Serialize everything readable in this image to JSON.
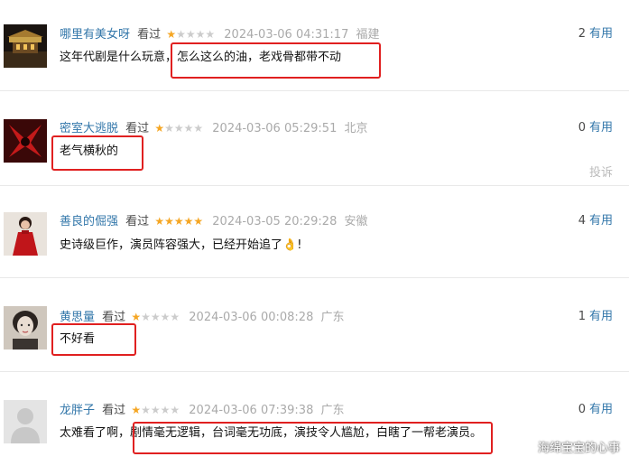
{
  "comments": [
    {
      "user": "哪里有美女呀",
      "watched": "看过",
      "rating": 1,
      "time": "2024-03-06 04:31:17",
      "location": "福建",
      "useful_count": "2",
      "useful_label": "有用",
      "text": "这年代剧是什么玩意，怎么这么的油，老戏骨都带不动",
      "avatar": "night-building-avatar"
    },
    {
      "user": "密室大逃脱",
      "watched": "看过",
      "rating": 1,
      "time": "2024-03-06 05:29:51",
      "location": "北京",
      "useful_count": "0",
      "useful_label": "有用",
      "text": "老气横秋的",
      "report": "投诉",
      "avatar": "red-claw-avatar"
    },
    {
      "user": "善良的倔强",
      "watched": "看过",
      "rating": 5,
      "time": "2024-03-05 20:29:28",
      "location": "安徽",
      "useful_count": "4",
      "useful_label": "有用",
      "text": "史诗级巨作，演员阵容强大，已经开始追了",
      "text_suffix": "👌!",
      "avatar": "red-dress-avatar"
    },
    {
      "user": "黄思量",
      "watched": "看过",
      "rating": 1,
      "time": "2024-03-06 00:08:28",
      "location": "广东",
      "useful_count": "1",
      "useful_label": "有用",
      "text": "不好看",
      "avatar": "vintage-portrait-avatar"
    },
    {
      "user": "龙胖子",
      "watched": "看过",
      "rating": 1,
      "time": "2024-03-06 07:39:38",
      "location": "广东",
      "useful_count": "0",
      "useful_label": "有用",
      "text": "太难看了啊，剧情毫无逻辑，台词毫无功底，演技令人尴尬，白瞎了一帮老演员。",
      "avatar": "default-user-avatar"
    }
  ],
  "watermark": "海绵宝宝的心事",
  "colors": {
    "username": "#3377aa",
    "star_on": "#f5a623",
    "star_off": "#cccccc",
    "highlight_box": "#e02020",
    "meta_gray": "#aaaaaa"
  }
}
